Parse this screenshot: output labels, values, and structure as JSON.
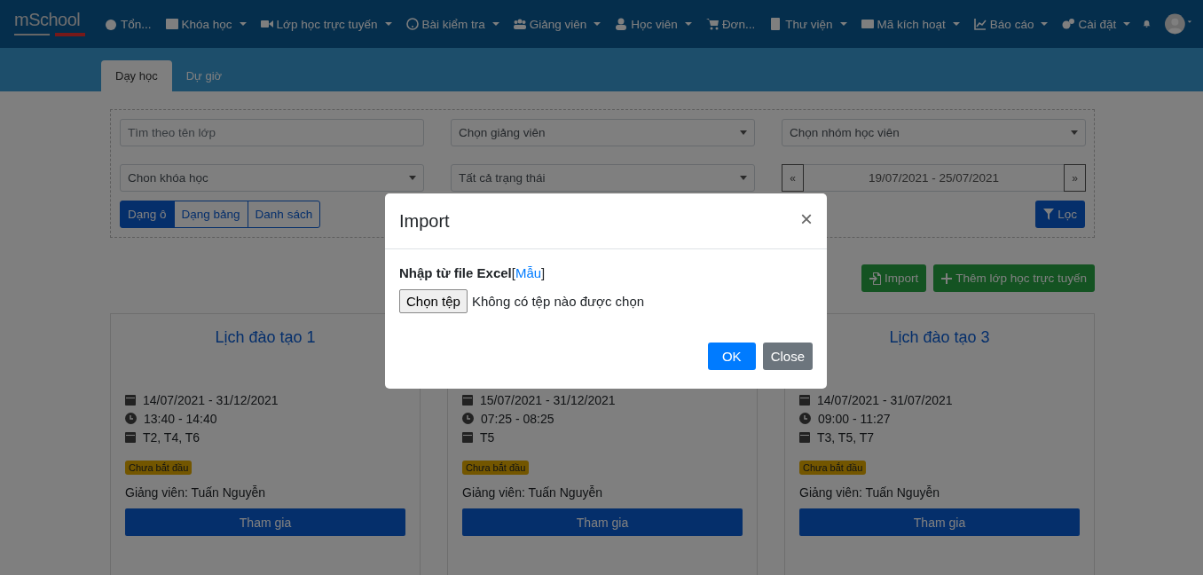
{
  "logo": {
    "text": "mSchool"
  },
  "nav": [
    {
      "label": "Tổn...",
      "caret": false
    },
    {
      "label": "Khóa học",
      "caret": true
    },
    {
      "label": "Lớp học trực tuyến",
      "caret": true
    },
    {
      "label": "Bài kiểm tra",
      "caret": true
    },
    {
      "label": "Giảng viên",
      "caret": true
    },
    {
      "label": "Học viên",
      "caret": true
    },
    {
      "label": "Đơn...",
      "caret": false
    },
    {
      "label": "Thư viện",
      "caret": true
    },
    {
      "label": "Mã kích hoạt",
      "caret": true
    },
    {
      "label": "Báo cáo",
      "caret": true
    },
    {
      "label": "Cài đặt",
      "caret": true
    }
  ],
  "tabs": [
    {
      "label": "Dạy học",
      "selected": true
    },
    {
      "label": "Dự giờ",
      "selected": false
    }
  ],
  "filters": {
    "search": {
      "placeholder": "Tìm theo tên lớp"
    },
    "selects": [
      {
        "value": "Chọn giảng viên"
      },
      {
        "value": "Chọn nhóm học viên"
      },
      {
        "value": "Chon khóa học"
      },
      {
        "value": "Tất cả trạng thái"
      }
    ],
    "date_range": {
      "prev": "«",
      "value": "19/07/2021 - 25/07/2021",
      "next": "»"
    },
    "views": [
      {
        "label": "Dạng ô",
        "selected": true
      },
      {
        "label": "Dạng bảng",
        "selected": false
      },
      {
        "label": "Danh sách",
        "selected": false
      }
    ],
    "filter_button": "Lọc"
  },
  "actions": [
    {
      "kind": "import",
      "label": "Import"
    },
    {
      "kind": "add",
      "label": "Thêm lớp học trực tuyến"
    }
  ],
  "cards": [
    {
      "title": "Lịch đào tạo 1",
      "dates": "14/07/2021 - 31/12/2021",
      "time": "13:40 - 14:40",
      "days": "T2, T4, T6",
      "status": "Chưa bắt đầu",
      "teacher": "Giảng viên: Tuấn Nguyễn",
      "button": "Tham gia"
    },
    {
      "dates": "15/07/2021 - 31/12/2021",
      "time": "07:25 - 08:25",
      "days": "T5",
      "status": "Chưa bắt đầu",
      "teacher": "Giảng viên: Tuấn Nguyễn",
      "button": "Tham gia"
    },
    {
      "title": "Lịch đào tạo 3",
      "dates": "14/07/2021 - 31/07/2021",
      "time": "09:00 - 11:27",
      "days": "T3, T5, T7",
      "status": "Chưa bắt đầu",
      "teacher": "Giảng viên: Tuấn Nguyễn",
      "button": "Tham gia"
    }
  ],
  "modal": {
    "title": "Import",
    "close": "×",
    "label": "Nhập từ file Excel",
    "bracket_open": "[",
    "link": "Mẫu",
    "bracket_close": "]",
    "file_button": "Chọn tệp",
    "file_status": "Không có tệp nào được chọn",
    "ok": "OK",
    "cancel": "Close"
  }
}
